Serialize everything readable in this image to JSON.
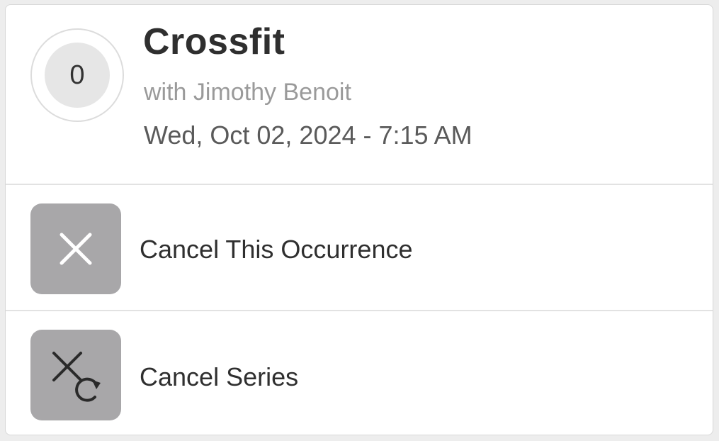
{
  "event": {
    "title": "Crossfit",
    "instructor": "with Jimothy Benoit",
    "datetime": "Wed, Oct 02, 2024 - 7:15 AM",
    "count": "0"
  },
  "actions": [
    {
      "label": "Cancel This Occurrence",
      "icon": "close-icon"
    },
    {
      "label": "Cancel Series",
      "icon": "cancel-series-icon"
    }
  ],
  "colors": {
    "icon_bg": "#a8a7a9",
    "title": "#2f2f2f",
    "subtitle": "#9a9a9a",
    "datetime": "#5a5a5a"
  }
}
